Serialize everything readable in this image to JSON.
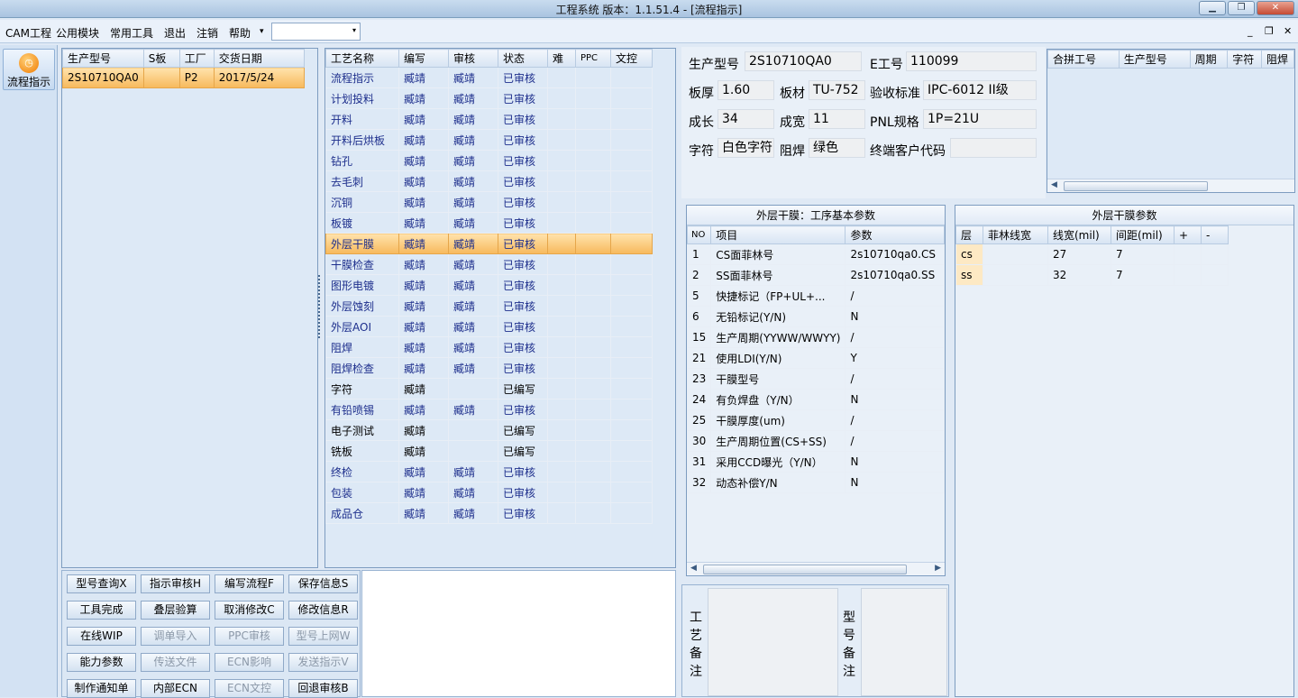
{
  "window": {
    "title": "工程系统   版本：1.1.51.4 - [流程指示]",
    "minimize": "▁",
    "restore": "❐",
    "close": "✕"
  },
  "menu": {
    "items": [
      "CAM工程",
      "公用模块",
      "常用工具",
      "退出",
      "注销",
      "帮助"
    ],
    "help_arrow": "▾",
    "combo_value": "",
    "combo_arrow": "▾",
    "mdi_min": "_",
    "mdi_restore": "❐",
    "mdi_close": "✕"
  },
  "nav": {
    "button_label": "流程指示",
    "icon": "clock-icon"
  },
  "model_list": {
    "headers": [
      "生产型号",
      "S板",
      "工厂",
      "交货日期"
    ],
    "rows": [
      {
        "model": "2S10710QA0",
        "s": "",
        "factory": "P2",
        "date": "2017/5/24"
      }
    ]
  },
  "process_list": {
    "headers": [
      "工艺名称",
      "编写",
      "审核",
      "状态",
      "难",
      "PPC",
      "文控"
    ],
    "rows": [
      [
        "流程指示",
        "臧靖",
        "臧靖",
        "已审核"
      ],
      [
        "计划投料",
        "臧靖",
        "臧靖",
        "已审核"
      ],
      [
        "开料",
        "臧靖",
        "臧靖",
        "已审核"
      ],
      [
        "开料后烘板",
        "臧靖",
        "臧靖",
        "已审核"
      ],
      [
        "钻孔",
        "臧靖",
        "臧靖",
        "已审核"
      ],
      [
        "去毛刺",
        "臧靖",
        "臧靖",
        "已审核"
      ],
      [
        "沉铜",
        "臧靖",
        "臧靖",
        "已审核"
      ],
      [
        "板镀",
        "臧靖",
        "臧靖",
        "已审核"
      ],
      [
        "外层干膜",
        "臧靖",
        "臧靖",
        "已审核"
      ],
      [
        "干膜检查",
        "臧靖",
        "臧靖",
        "已审核"
      ],
      [
        "图形电镀",
        "臧靖",
        "臧靖",
        "已审核"
      ],
      [
        "外层蚀刻",
        "臧靖",
        "臧靖",
        "已审核"
      ],
      [
        "外层AOI",
        "臧靖",
        "臧靖",
        "已审核"
      ],
      [
        "阻焊",
        "臧靖",
        "臧靖",
        "已审核"
      ],
      [
        "阻焊检查",
        "臧靖",
        "臧靖",
        "已审核"
      ],
      [
        "字符",
        "臧靖",
        "",
        "已编写"
      ],
      [
        "有铅喷锡",
        "臧靖",
        "臧靖",
        "已审核"
      ],
      [
        "电子测试",
        "臧靖",
        "",
        "已编写"
      ],
      [
        "铣板",
        "臧靖",
        "",
        "已编写"
      ],
      [
        "终检",
        "臧靖",
        "臧靖",
        "已审核"
      ],
      [
        "包装",
        "臧靖",
        "臧靖",
        "已审核"
      ],
      [
        "成品仓",
        "臧靖",
        "臧靖",
        "已审核"
      ]
    ],
    "selected_index": 8,
    "black_rows": [
      15,
      17,
      18
    ]
  },
  "buttons": [
    {
      "label": "型号查询X",
      "enabled": true
    },
    {
      "label": "指示审核H",
      "enabled": true
    },
    {
      "label": "编写流程F",
      "enabled": true
    },
    {
      "label": "保存信息S",
      "enabled": true
    },
    {
      "label": "工具完成",
      "enabled": true
    },
    {
      "label": "叠层验算",
      "enabled": true
    },
    {
      "label": "取消修改C",
      "enabled": true
    },
    {
      "label": "修改信息R",
      "enabled": true
    },
    {
      "label": "在线WIP",
      "enabled": true
    },
    {
      "label": "调单导入",
      "enabled": false
    },
    {
      "label": "PPC审核",
      "enabled": false
    },
    {
      "label": "型号上网W",
      "enabled": false
    },
    {
      "label": "能力参数",
      "enabled": true
    },
    {
      "label": "传送文件",
      "enabled": false
    },
    {
      "label": "ECN影响",
      "enabled": false
    },
    {
      "label": "发送指示V",
      "enabled": false
    },
    {
      "label": "制作通知单",
      "enabled": true
    },
    {
      "label": "内部ECN",
      "enabled": true
    },
    {
      "label": "ECN文控",
      "enabled": false
    },
    {
      "label": "回退审核B",
      "enabled": true
    }
  ],
  "info": {
    "model_label": "生产型号",
    "model_value": "2S10710QA0",
    "e_label": "E工号",
    "e_value": "110099",
    "thick_label": "板厚",
    "thick_value": "1.60",
    "mat_label": "板材",
    "mat_value": "TU-752",
    "std_label": "验收标准",
    "std_value": "IPC-6012 II级",
    "len_label": "成长",
    "len_value": "34",
    "wid_label": "成宽",
    "wid_value": "11",
    "pnl_label": "PNL规格",
    "pnl_value": "1P=21U",
    "char_label": "字符",
    "char_value": "白色字符",
    "mask_label": "阻焊",
    "mask_value": "绿色",
    "cust_label": "终端客户代码",
    "cust_value": ""
  },
  "merge": {
    "headers": [
      "合拼工号",
      "生产型号",
      "周期",
      "字符",
      "阻焊"
    ]
  },
  "basic_params": {
    "title": "外层干膜：工序基本参数",
    "headers": [
      "NO",
      "项目",
      "参数"
    ],
    "rows": [
      [
        "1",
        "CS面菲林号",
        "2s10710qa0.CS"
      ],
      [
        "2",
        "SS面菲林号",
        "2s10710qa0.SS"
      ],
      [
        "5",
        "快捷标记（FP+UL+...",
        "/"
      ],
      [
        "6",
        "无铅标记(Y/N)",
        "N"
      ],
      [
        "15",
        "生产周期(YYWW/WWYY)",
        "/"
      ],
      [
        "21",
        "使用LDI(Y/N)",
        "Y"
      ],
      [
        "23",
        "干膜型号",
        "/"
      ],
      [
        "24",
        "有负焊盘（Y/N）",
        "N"
      ],
      [
        "25",
        "干膜厚度(um)",
        "/"
      ],
      [
        "30",
        "生产周期位置(CS+SS)",
        "/"
      ],
      [
        "31",
        "采用CCD曝光（Y/N）",
        "N"
      ],
      [
        "32",
        "动态补偿Y/N",
        "N"
      ]
    ]
  },
  "film_params": {
    "title": "外层干膜参数",
    "headers": [
      "层",
      "菲林线宽",
      "线宽(mil)",
      "间距(mil)",
      "+",
      "-"
    ],
    "rows": [
      [
        "cs",
        "",
        "27",
        "7",
        "",
        ""
      ],
      [
        "ss",
        "",
        "32",
        "7",
        "",
        ""
      ]
    ]
  },
  "remarks": {
    "process_label": "工艺备注",
    "model_label": "型号备注"
  }
}
